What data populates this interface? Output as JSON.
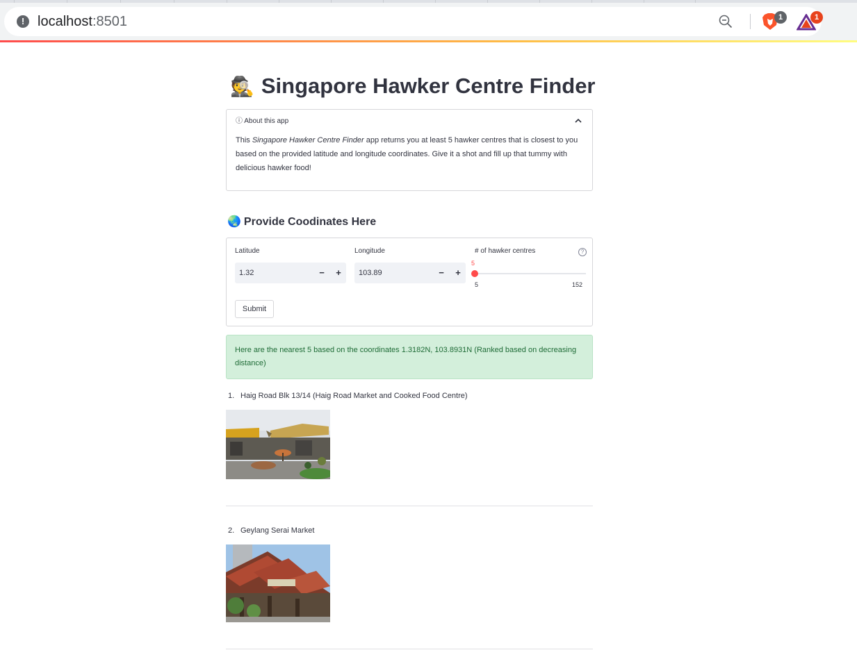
{
  "browser": {
    "url_host": "localhost",
    "url_port": ":8501",
    "brave_badge": "1",
    "rewards_badge": "1"
  },
  "app": {
    "title_emoji": "🕵️",
    "title": "Singapore Hawker Centre Finder",
    "about": {
      "header": "ⓘ About this app",
      "body_prefix": "This ",
      "body_italic": "Singapore Hawker Centre Finder",
      "body_suffix": " app returns you at least 5 hawker centres that is closest to you based on the provided latitude and longitude coordinates. Give it a shot and fill up that tummy with delicious hawker food!"
    },
    "subheader_emoji": "🌏",
    "subheader": "Provide Coodinates Here",
    "form": {
      "latitude_label": "Latitude",
      "latitude_value": "1.32",
      "longitude_label": "Longitude",
      "longitude_value": "103.89",
      "minus": "−",
      "plus": "+",
      "slider_label": "# of hawker centres",
      "help_glyph": "?",
      "slider_value": 5,
      "slider_value_text": "5",
      "slider_min_text": "5",
      "slider_max_text": "152",
      "slider_min": 5,
      "slider_max": 152,
      "submit_label": "Submit"
    },
    "alert": "Here are the nearest 5 based on the coordinates 1.3182N, 103.8931N (Ranked based on decreasing distance)",
    "results": [
      {
        "num": "1.",
        "name": "Haig Road Blk 13/14 (Haig Road Market and Cooked Food Centre)"
      },
      {
        "num": "2.",
        "name": "Geylang Serai Market"
      }
    ]
  },
  "colors": {
    "accent": "#ff4b4b",
    "alert_bg": "#d3efdb",
    "alert_text": "#1e6b36"
  }
}
